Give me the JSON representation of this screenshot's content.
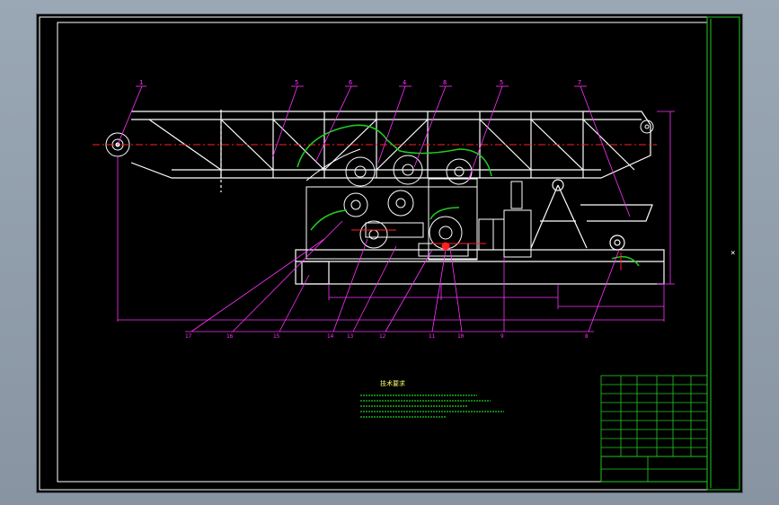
{
  "window": {
    "background": "#8f9ba8",
    "viewport_bg": "#000000"
  },
  "colors": {
    "frame": "#ffffff",
    "green": "#22cc22",
    "magenta": "#ff33ff",
    "red": "#ff2020",
    "white": "#ffffff",
    "dim": "#d9d9d9"
  },
  "balloons": {
    "top": [
      "1",
      "5",
      "6",
      "4",
      "8",
      "5",
      "7"
    ],
    "bottom": [
      "17",
      "16",
      "15",
      "14",
      "13",
      "12",
      "11",
      "10",
      "9",
      "8"
    ]
  },
  "dimensions": {
    "overall_height": "",
    "base_spans": [
      "",
      "",
      "",
      ""
    ]
  },
  "notes": {
    "title": "技术要求",
    "lines": [
      "",
      "",
      "",
      "",
      ""
    ]
  },
  "title_block": {
    "drawing_no": "",
    "scale": "",
    "sheet": ""
  }
}
